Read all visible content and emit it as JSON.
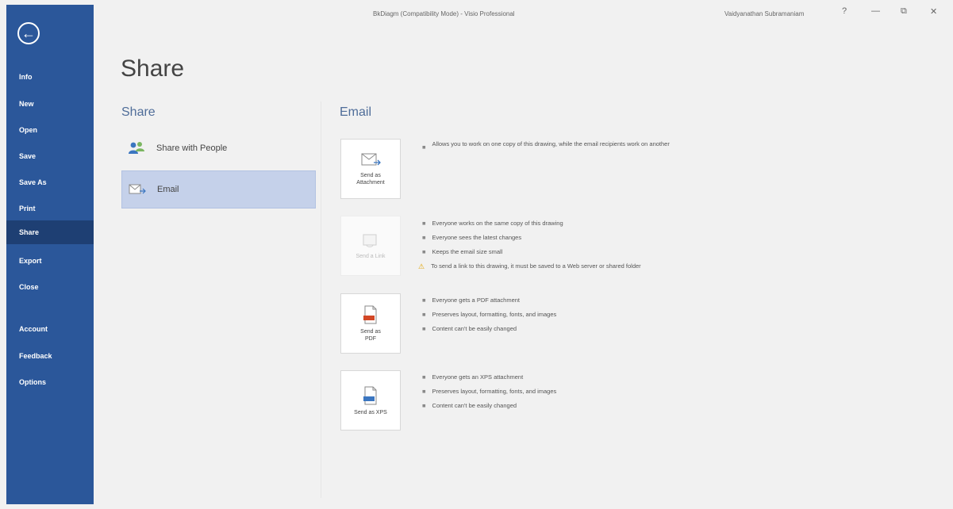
{
  "window": {
    "title": "BkDiagm (Compatibility Mode) - Visio Professional",
    "user": "Vaidyanathan Subramaniam",
    "help": "?",
    "minimize": "—",
    "restore": "⧉",
    "close": "✕"
  },
  "nav": {
    "back": "←",
    "items": [
      {
        "label": "Info"
      },
      {
        "label": "New"
      },
      {
        "label": "Open"
      },
      {
        "label": "Save"
      },
      {
        "label": "Save As"
      },
      {
        "label": "Print"
      },
      {
        "label": "Share"
      },
      {
        "label": "Export"
      },
      {
        "label": "Close"
      },
      {
        "label": "Account"
      },
      {
        "label": "Feedback"
      },
      {
        "label": "Options"
      }
    ],
    "active": "Share"
  },
  "page_title": "Share",
  "share": {
    "heading": "Share",
    "options": [
      {
        "label": "Share with People"
      },
      {
        "label": "Email"
      }
    ]
  },
  "email": {
    "heading": "Email",
    "cards": [
      {
        "label": "Send as\nAttachment",
        "bullets": [
          "Allows you to work on one copy of this drawing, while the email recipients work on another"
        ]
      },
      {
        "label": "Send a Link",
        "bullets": [
          "Everyone works on the same copy of this drawing",
          "Everyone sees the latest changes",
          "Keeps the email size small"
        ],
        "warning": "To send a link to this drawing, it must be saved to a Web server or shared folder"
      },
      {
        "label": "Send as\nPDF",
        "bullets": [
          "Everyone gets a PDF attachment",
          "Preserves layout, formatting, fonts, and images",
          "Content can't be easily changed"
        ]
      },
      {
        "label": "Send as XPS",
        "bullets": [
          "Everyone gets an XPS attachment",
          "Preserves layout, formatting, fonts, and images",
          "Content can't be easily changed"
        ]
      }
    ]
  }
}
